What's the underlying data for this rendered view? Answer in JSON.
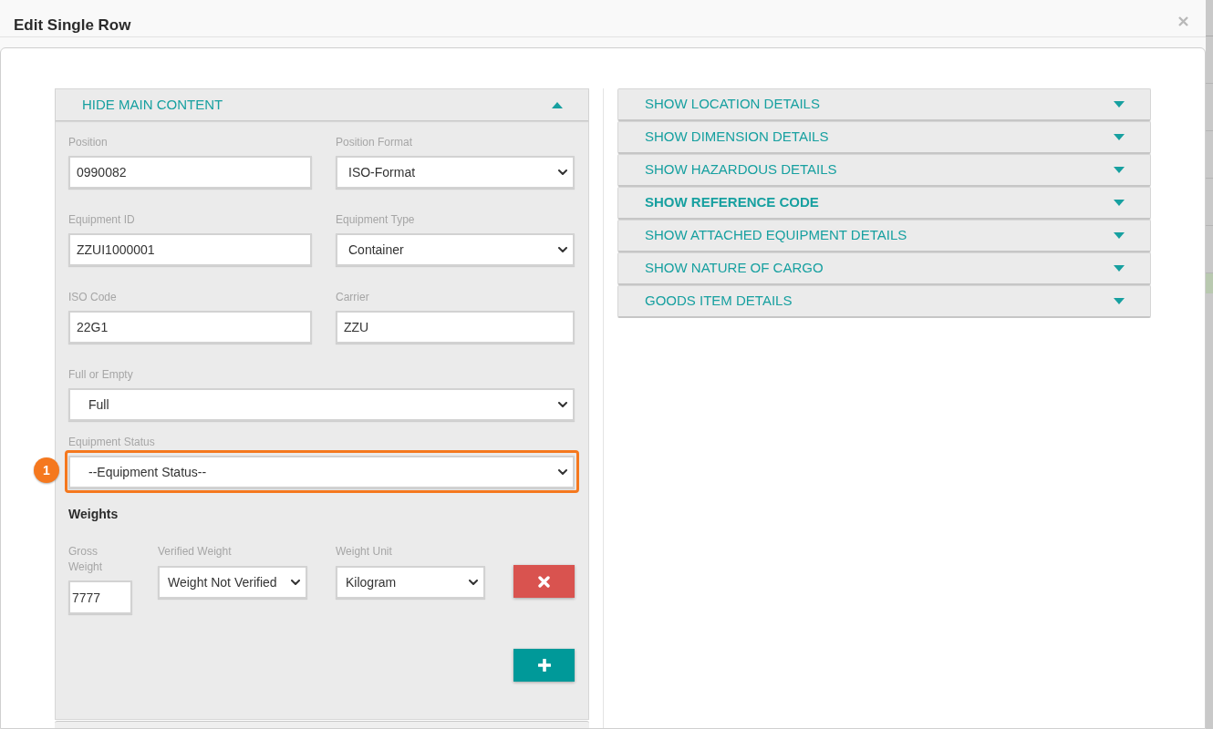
{
  "dialog": {
    "title": "Edit Single Row"
  },
  "main_section": {
    "header": "HIDE MAIN CONTENT",
    "expanded": true,
    "field_rows": [
      {
        "fields": [
          {
            "kind": "input",
            "label": "Position",
            "value": "0990082",
            "highlighted": false
          },
          {
            "kind": "select",
            "label": "Position Format",
            "value": "ISO-Format",
            "highlighted": false
          }
        ]
      },
      {
        "fields": [
          {
            "kind": "input",
            "label": "Equipment ID",
            "value": "ZZUI1000001",
            "highlighted": false
          },
          {
            "kind": "select",
            "label": "Equipment Type",
            "value": "Container",
            "highlighted": false
          }
        ]
      },
      {
        "fields": [
          {
            "kind": "input",
            "label": "ISO Code",
            "value": "22G1",
            "highlighted": false
          },
          {
            "kind": "input",
            "label": "Carrier",
            "value": "ZZU",
            "highlighted": false
          }
        ]
      },
      {
        "fields": [
          {
            "kind": "select",
            "label": "Full or Empty",
            "value": "Full",
            "highlighted": false
          }
        ]
      },
      {
        "fields": [
          {
            "kind": "select",
            "label": "Equipment Status",
            "value": "--Equipment Status--",
            "highlighted": true,
            "callout": "1"
          }
        ]
      }
    ],
    "weights": {
      "heading": "Weights",
      "rows": [
        {
          "gross_weight": {
            "label": "Gross Weight",
            "value": "7777"
          },
          "verified_weight": {
            "label": "Verified Weight",
            "value": "Weight Not Verified"
          },
          "weight_unit": {
            "label": "Weight Unit",
            "value": "Kilogram"
          }
        }
      ]
    }
  },
  "sections": [
    {
      "label": "SHOW LOCATION DETAILS",
      "expanded": false,
      "emphasized": false
    },
    {
      "label": "SHOW DIMENSION DETAILS",
      "expanded": false,
      "emphasized": false
    },
    {
      "label": "SHOW HAZARDOUS DETAILS",
      "expanded": false,
      "emphasized": false
    },
    {
      "label": "SHOW REFERENCE CODE",
      "expanded": false,
      "emphasized": true
    },
    {
      "label": "SHOW ATTACHED EQUIPMENT DETAILS",
      "expanded": false,
      "emphasized": false
    },
    {
      "label": "SHOW NATURE OF CARGO",
      "expanded": false,
      "emphasized": false
    },
    {
      "label": "GOODS ITEM DETAILS",
      "expanded": false,
      "emphasized": false
    }
  ]
}
